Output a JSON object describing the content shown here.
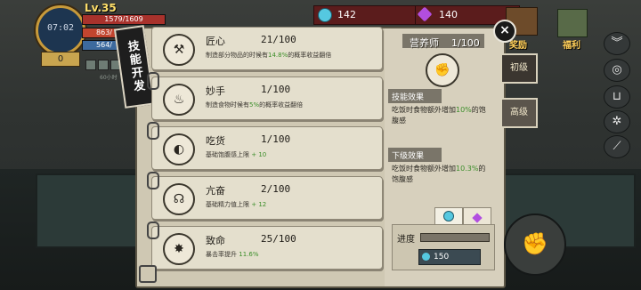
{
  "hud": {
    "level": "Lv.35",
    "clock": "07:02",
    "hp": "1579/1609",
    "stat2": "863/",
    "stat3": "564/",
    "money": "0",
    "hours_label": "60小时"
  },
  "currency": {
    "cyan_gems": "142",
    "purple_gems": "140"
  },
  "top_right": {
    "reward_label": "奖励",
    "welfare_label": "福利"
  },
  "side_icons": [
    "chevron-double-down-icon",
    "medal-icon",
    "cart-icon",
    "settings-icon",
    "sword-icon"
  ],
  "panel": {
    "tag_title": "技能开发",
    "close_label": "×",
    "tabs": {
      "primary": "初级",
      "advanced": "高级"
    },
    "skills": [
      {
        "name": "匠心",
        "level": "21/100",
        "desc_pre": "制造部分物品的时候有",
        "desc_hl": "14.8%",
        "desc_post": "的概率收益翻倍",
        "icon": "hammer-wrench-icon"
      },
      {
        "name": "妙手",
        "level": "1/100",
        "desc_pre": "制造食物时候有",
        "desc_hl": "5%",
        "desc_post": "的概率收益翻倍",
        "icon": "chef-hat-icon"
      },
      {
        "name": "吃货",
        "level": "1/100",
        "desc_pre": "基础饱腹感上限",
        "desc_hl": "+ 10",
        "desc_post": "",
        "icon": "stomach-icon"
      },
      {
        "name": "亢奋",
        "level": "2/100",
        "desc_pre": "基础精力值上限",
        "desc_hl": "+ 12",
        "desc_post": "",
        "icon": "brain-head-icon"
      },
      {
        "name": "致命",
        "level": "25/100",
        "desc_pre": "暴击率提升",
        "desc_hl": "11.6%",
        "desc_post": "",
        "icon": "burst-icon"
      }
    ],
    "detail": {
      "title": "营养师",
      "level": "1/100",
      "effect_title": "技能效果",
      "effect_pre": "吃饭时食物额外增加",
      "effect_hl": "10%",
      "effect_post": "的饱腹感",
      "next_title": "下级效果",
      "next_pre": "吃饭时食物额外增加",
      "next_hl": "10.3%",
      "next_post": "的饱腹感",
      "progress_label": "进度",
      "progress": 0,
      "cost": "150"
    }
  }
}
